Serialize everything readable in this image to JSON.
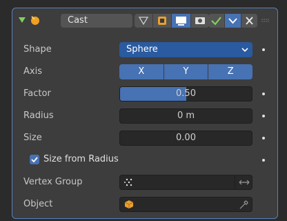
{
  "modifier": {
    "name": "Cast",
    "colors": {
      "accent": "#4772b3",
      "expand_arrow": "#7fd15b",
      "check": "#7fd15b",
      "panel_border": "#5680c2"
    },
    "header_icons": [
      "expand-arrow-icon",
      "cast-modifier-icon",
      "edit-mode-cage-icon",
      "edit-mode-icon",
      "viewport-display-icon",
      "render-icon",
      "apply-check-icon",
      "dropdown-menu-icon",
      "close-icon",
      "drag-grip-icon"
    ]
  },
  "fields": {
    "shape": {
      "label": "Shape",
      "value": "Sphere"
    },
    "axis": {
      "label": "Axis",
      "options": [
        "X",
        "Y",
        "Z"
      ]
    },
    "factor": {
      "label": "Factor",
      "value": "0.50",
      "fraction": 0.5
    },
    "radius": {
      "label": "Radius",
      "value": "0 m"
    },
    "size": {
      "label": "Size",
      "value": "0.00"
    },
    "size_from_radius": {
      "label": "Size from Radius",
      "checked": true
    },
    "vertex_group": {
      "label": "Vertex Group",
      "value": ""
    },
    "object": {
      "label": "Object",
      "value": ""
    }
  }
}
